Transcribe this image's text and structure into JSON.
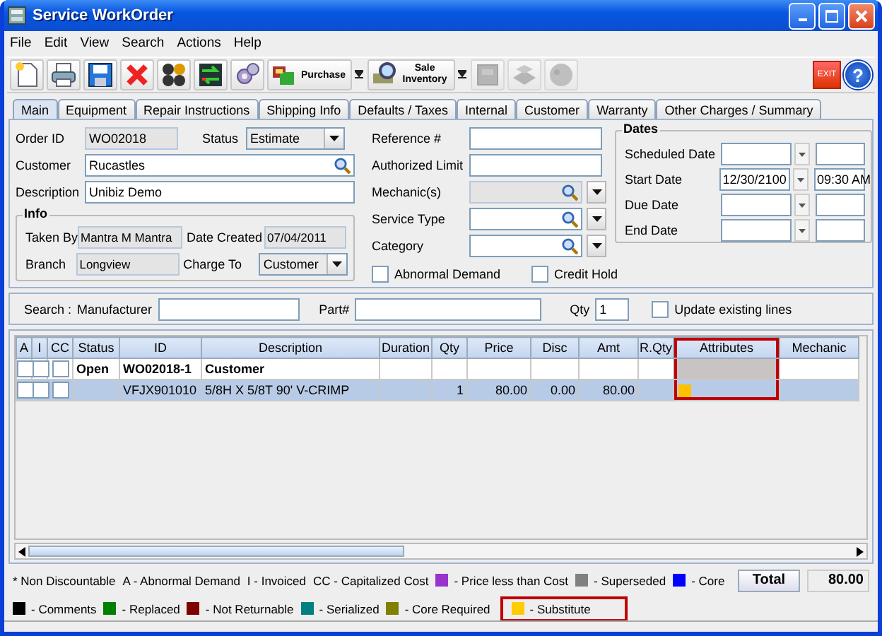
{
  "window": {
    "title": "Service WorkOrder"
  },
  "menu": [
    {
      "label": "File"
    },
    {
      "label": "Edit"
    },
    {
      "label": "View"
    },
    {
      "label": "Search"
    },
    {
      "label": "Actions"
    },
    {
      "label": "Help"
    }
  ],
  "toolbar": [
    {
      "kind": "new",
      "disabled": false
    },
    {
      "kind": "print",
      "disabled": false
    },
    {
      "kind": "save",
      "disabled": false
    },
    {
      "kind": "delete",
      "disabled": false
    },
    {
      "kind": "balls",
      "disabled": false
    },
    {
      "kind": "swap",
      "disabled": false
    },
    {
      "kind": "gears",
      "disabled": false
    },
    {
      "kind": "purchase",
      "label": "Purchase",
      "disabled": false
    },
    {
      "kind": "sale",
      "label": "Sale Inventory",
      "disabled": false
    },
    {
      "kind": "box",
      "disabled": true
    },
    {
      "kind": "stack",
      "disabled": true
    },
    {
      "kind": "face",
      "disabled": true
    }
  ],
  "toolbar_right": [
    {
      "kind": "exit",
      "label": "EXIT"
    },
    {
      "kind": "help",
      "label": "?"
    }
  ],
  "tabs": [
    {
      "label": "Main",
      "selected": true
    },
    {
      "label": "Equipment",
      "selected": false
    },
    {
      "label": "Repair Instructions",
      "selected": false
    },
    {
      "label": "Shipping Info",
      "selected": false
    },
    {
      "label": "Defaults / Taxes",
      "selected": false
    },
    {
      "label": "Internal",
      "selected": false
    },
    {
      "label": "Customer",
      "selected": false
    },
    {
      "label": "Warranty",
      "selected": false
    },
    {
      "label": "Other Charges / Summary",
      "selected": false
    }
  ],
  "order": {
    "order_id": {
      "label": "Order ID",
      "value": "WO02018"
    },
    "status": {
      "label": "Status",
      "value": "Estimate"
    },
    "customer": {
      "label": "Customer",
      "value": "Rucastles"
    },
    "description": {
      "label": "Description",
      "value": "Unibiz Demo"
    }
  },
  "info": {
    "title": "Info",
    "taken_by": {
      "label": "Taken By",
      "value": "Mantra M Mantra"
    },
    "date_created": {
      "label": "Date Created",
      "value": "07/04/2011"
    },
    "branch": {
      "label": "Branch",
      "value": "Longview"
    },
    "charge_to": {
      "label": "Charge To",
      "value": "Customer"
    }
  },
  "middle": {
    "fields": [
      {
        "label": "Reference #",
        "kind": "text",
        "disabled": false
      },
      {
        "label": "Authorized Limit",
        "kind": "text",
        "disabled": false
      },
      {
        "label": "Mechanic(s)",
        "kind": "lookup",
        "disabled": true
      },
      {
        "label": "Service Type",
        "kind": "lookup",
        "disabled": false
      },
      {
        "label": "Category",
        "kind": "lookup",
        "disabled": false
      }
    ],
    "checkboxes": [
      {
        "label": "Abnormal Demand",
        "checked": false
      },
      {
        "label": "Credit Hold",
        "checked": false
      }
    ]
  },
  "dates": {
    "title": "Dates",
    "rows": [
      {
        "label": "Scheduled Date"
      },
      {
        "label": "Start Date",
        "date": "12/30/2100",
        "time": "09:30 AM"
      },
      {
        "label": "Due Date"
      },
      {
        "label": "End Date"
      }
    ]
  },
  "search": {
    "label": "Search :",
    "manufacturer_label": "Manufacturer",
    "part_label": "Part#",
    "qty_label": "Qty",
    "qty": "1",
    "update": {
      "label": "Update existing lines",
      "checked": false
    }
  },
  "table": {
    "columns": [
      {
        "label": "A",
        "highlighted": false
      },
      {
        "label": "I",
        "highlighted": false
      },
      {
        "label": "CC",
        "highlighted": false
      },
      {
        "label": "Status",
        "highlighted": false
      },
      {
        "label": "ID",
        "highlighted": false
      },
      {
        "label": "Description",
        "highlighted": false
      },
      {
        "label": "Duration",
        "highlighted": false
      },
      {
        "label": "Qty",
        "highlighted": false
      },
      {
        "label": "Price",
        "highlighted": false
      },
      {
        "label": "Disc",
        "highlighted": false
      },
      {
        "label": "Amt",
        "highlighted": false
      },
      {
        "label": "R.Qty",
        "highlighted": false
      },
      {
        "label": "Attributes",
        "highlighted": true
      },
      {
        "label": "Mechanic",
        "highlighted": false
      }
    ],
    "rows": [
      {
        "kind": "group",
        "selected": false,
        "a": false,
        "i": false,
        "cc": false,
        "status": "Open",
        "id": "WO02018-1",
        "description": "Customer"
      },
      {
        "kind": "line",
        "selected": true,
        "a": false,
        "i": false,
        "cc": false,
        "id": "VFJX901010",
        "description": "5/8H X 5/8T 90' V-CRIMP",
        "qty": "1",
        "price": "80.00",
        "disc": "0.00",
        "amt": "80.00",
        "attributes": [
          {
            "color": "#ffc000"
          }
        ]
      }
    ]
  },
  "legend": {
    "line_1": [
      {
        "kind": "text",
        "label": "* Non Discountable",
        "highlighted": false
      },
      {
        "kind": "text",
        "label": "A - Abnormal Demand",
        "highlighted": false
      },
      {
        "kind": "text",
        "label": "I - Invoiced",
        "highlighted": false
      },
      {
        "kind": "text",
        "label": "CC - Capitalized Cost",
        "highlighted": false
      },
      {
        "kind": "swatch",
        "color": "#9933cc",
        "label": "- Price less than Cost",
        "highlighted": false
      },
      {
        "kind": "swatch",
        "color": "#808080",
        "label": "- Superseded",
        "highlighted": false
      },
      {
        "kind": "swatch",
        "color": "#0000ff",
        "label": "- Core",
        "highlighted": false
      }
    ],
    "line_2": [
      {
        "kind": "swatch",
        "color": "#000000",
        "label": "- Comments",
        "highlighted": false
      },
      {
        "kind": "swatch",
        "color": "#008000",
        "label": "- Replaced",
        "highlighted": false
      },
      {
        "kind": "swatch",
        "color": "#800000",
        "label": "- Not Returnable",
        "highlighted": false
      },
      {
        "kind": "swatch",
        "color": "#008080",
        "label": "- Serialized",
        "highlighted": false
      },
      {
        "kind": "swatch",
        "color": "#808000",
        "label": "- Core Required",
        "highlighted": false
      },
      {
        "kind": "swatch",
        "color": "#ffcc00",
        "label": "- Substitute",
        "highlighted": true
      }
    ],
    "total_label": "Total",
    "total": "80.00"
  }
}
